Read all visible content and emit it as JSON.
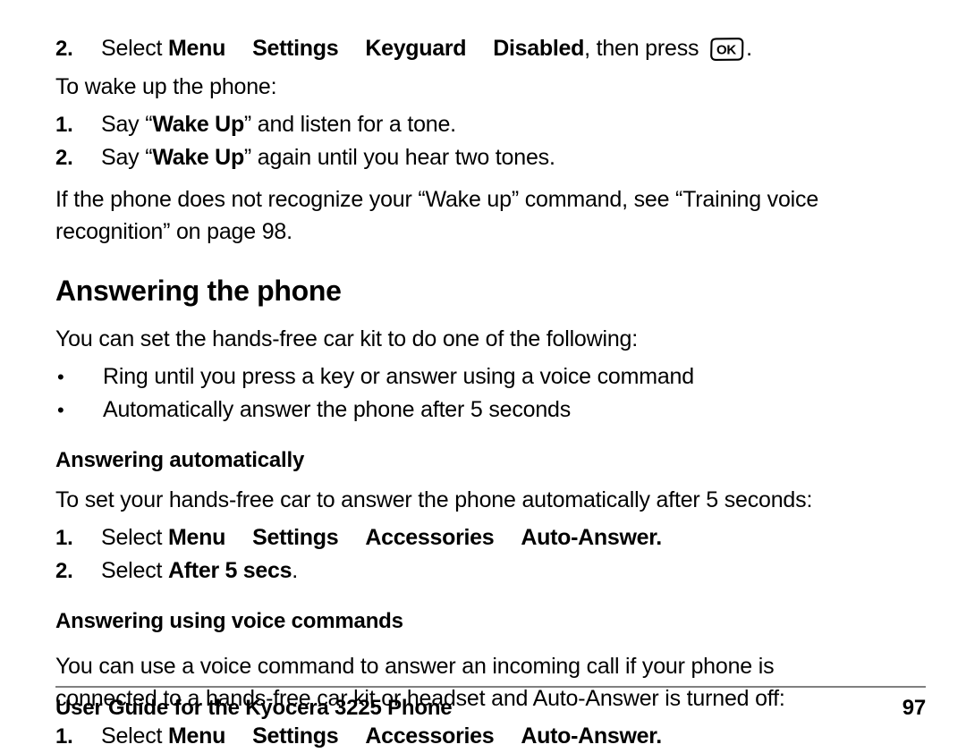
{
  "document": {
    "title": "User Guide for the Kyocera 3225 Phone",
    "page_number": "97"
  },
  "keyguard_step": {
    "number": "2.",
    "lead": "Select ",
    "path": [
      "Menu",
      "Settings",
      "Keyguard",
      "Disabled"
    ],
    "tail": ", then press ",
    "key_icon_label": "OK",
    "period": "."
  },
  "wake_section": {
    "intro": "To wake up the phone:",
    "steps": [
      {
        "number": "1.",
        "pre": "Say “",
        "bold": "Wake Up",
        "post": "” and listen for a tone."
      },
      {
        "number": "2.",
        "pre": "Say “",
        "bold": "Wake Up",
        "post": "” again until you hear two tones."
      }
    ],
    "note_line_1": "If the phone does not recognize your “Wake up” command, see “Training voice",
    "note_line_2": "recognition” on page 98."
  },
  "answering_section": {
    "heading": "Answering the phone",
    "intro": "You can set the hands-free car kit to do one of the following:",
    "bullet_marker": "•",
    "bullets": [
      "Ring until you press a key or answer using a voice command",
      "Automatically answer the phone after 5 seconds"
    ]
  },
  "auto_subsection": {
    "heading": "Answering automatically",
    "intro": "To set your hands-free car to answer the phone automatically after 5 seconds:",
    "steps": [
      {
        "number": "1.",
        "lead": "Select ",
        "path": [
          "Menu",
          "Settings",
          "Accessories",
          "Auto-Answer."
        ]
      },
      {
        "number": "2.",
        "lead": "Select ",
        "bold": "After 5 secs",
        "post": "."
      }
    ]
  },
  "voice_subsection": {
    "heading": "Answering using voice commands",
    "intro_line_1": "You can use a voice command to answer an incoming call if your phone is",
    "intro_line_2": "connected to a hands-free car kit or headset and Auto-Answer is turned off:",
    "steps": [
      {
        "number": "1.",
        "lead": "Select ",
        "path": [
          "Menu",
          "Settings",
          "Accessories",
          "Auto-Answer."
        ]
      }
    ]
  }
}
